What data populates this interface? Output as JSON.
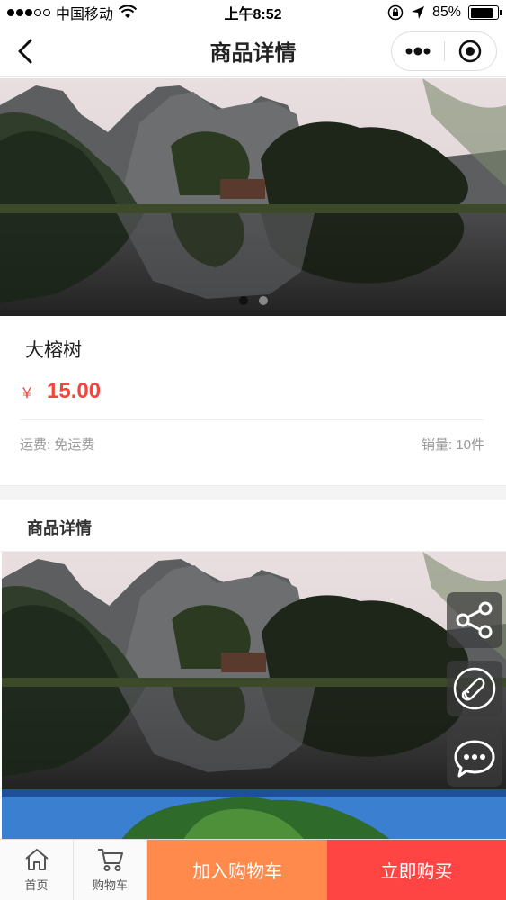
{
  "status_bar": {
    "carrier": "中国移动",
    "time": "上午8:52",
    "battery": "85%",
    "battery_level": 0.85
  },
  "nav": {
    "title": "商品详情",
    "back_icon": "chevron-left-icon",
    "more_icon": "more-dots-icon",
    "close_icon": "target-icon"
  },
  "banner": {
    "slide_count": 2,
    "active_index": 0
  },
  "product": {
    "name": "大榕树",
    "currency": "￥",
    "price": "15.00",
    "shipping": "运费: 免运费",
    "sales": "销量: 10件"
  },
  "detail": {
    "title": "商品详情"
  },
  "float_buttons": {
    "share_icon": "share-icon",
    "link_icon": "link-icon",
    "chat_icon": "chat-icon"
  },
  "bottom_bar": {
    "home_label": "首页",
    "cart_label": "购物车",
    "add_to_cart": "加入购物车",
    "buy_now": "立即购买"
  },
  "colors": {
    "price": "#f0463e",
    "add_to_cart_bg": "#ff8a4c",
    "buy_now_bg": "#ff4444"
  }
}
